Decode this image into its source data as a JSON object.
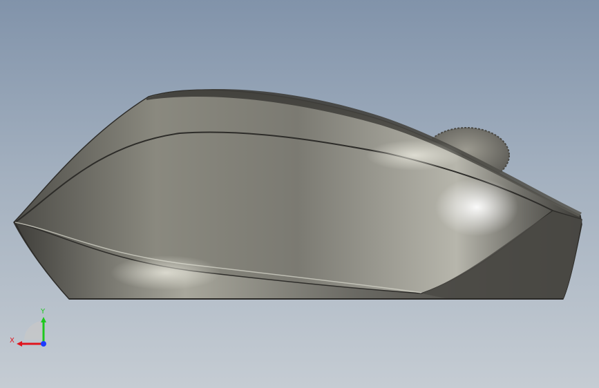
{
  "viewport": {
    "background_top": "#8193aa",
    "background_bottom": "#c5ccd3",
    "model_color": "#6b6a64"
  },
  "triad": {
    "x_label": "X",
    "y_label": "Y",
    "x_color": "#e0141e",
    "y_color": "#1ec81e",
    "z_color": "#1e3cff"
  }
}
